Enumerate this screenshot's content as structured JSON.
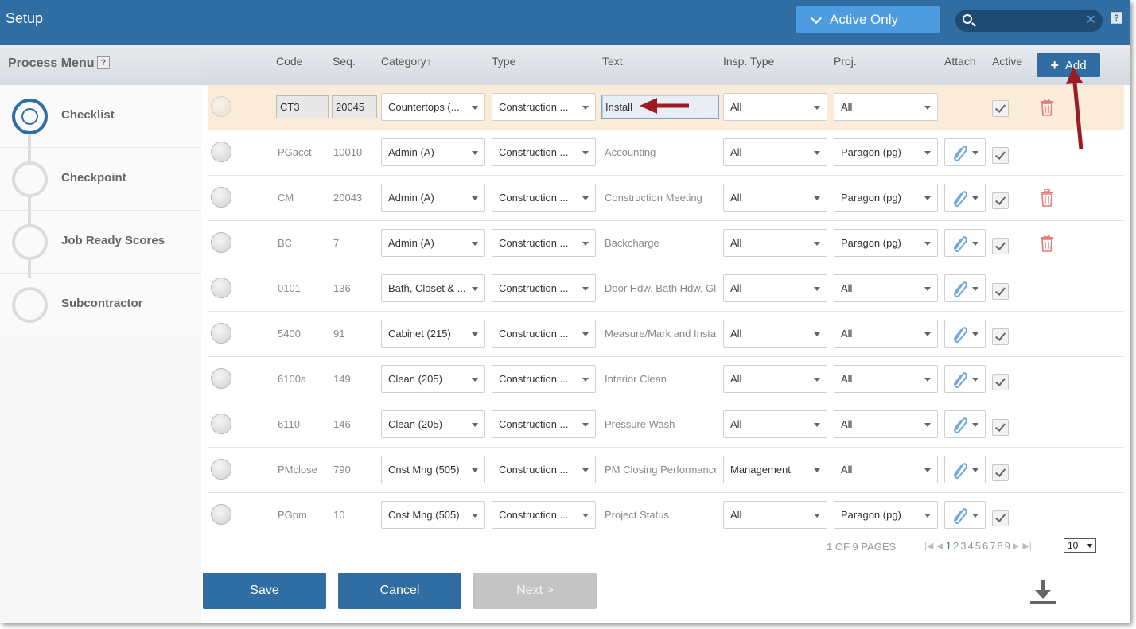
{
  "header": {
    "title": "Setup",
    "active_filter_label": "Active Only",
    "search_value": "",
    "help_label": "?"
  },
  "sidebar": {
    "title": "Process Menu",
    "help_label": "?",
    "steps": [
      {
        "label": "Checklist",
        "active": true
      },
      {
        "label": "Checkpoint",
        "active": false
      },
      {
        "label": "Job Ready Scores",
        "active": false
      },
      {
        "label": "Subcontractor",
        "active": false
      }
    ]
  },
  "columns": {
    "code": "Code",
    "seq": "Seq.",
    "category": "Category↑",
    "type": "Type",
    "text": "Text",
    "insp_type": "Insp. Type",
    "proj": "Proj.",
    "attach": "Attach",
    "active": "Active",
    "add_label": "Add"
  },
  "rows": [
    {
      "code": "CT3",
      "seq": "20045",
      "category": "Countertops (...",
      "type": "Construction ...",
      "text": "Install",
      "insp_type": "All",
      "proj": "All",
      "attach": false,
      "active": true,
      "delete": true
    },
    {
      "code": "PGacct",
      "seq": "10010",
      "category": "Admin (A)",
      "type": "Construction ...",
      "text": "Accounting",
      "insp_type": "All",
      "proj": "Paragon (pg)",
      "attach": true,
      "active": true,
      "delete": false
    },
    {
      "code": "CM",
      "seq": "20043",
      "category": "Admin (A)",
      "type": "Construction ...",
      "text": "Construction Meeting",
      "insp_type": "All",
      "proj": "Paragon (pg)",
      "attach": true,
      "active": true,
      "delete": true
    },
    {
      "code": "BC",
      "seq": "7",
      "category": "Admin (A)",
      "type": "Construction ...",
      "text": "Backcharge",
      "insp_type": "All",
      "proj": "Paragon (pg)",
      "attach": true,
      "active": true,
      "delete": true
    },
    {
      "code": "0101",
      "seq": "136",
      "category": "Bath, Closet & ...",
      "type": "Construction ...",
      "text": "Door Hdw, Bath Hdw, Gl",
      "insp_type": "All",
      "proj": "All",
      "attach": true,
      "active": true,
      "delete": false
    },
    {
      "code": "5400",
      "seq": "91",
      "category": "Cabinet (215)",
      "type": "Construction ...",
      "text": "Measure/Mark and Insta",
      "insp_type": "All",
      "proj": "All",
      "attach": true,
      "active": true,
      "delete": false
    },
    {
      "code": "6100a",
      "seq": "149",
      "category": "Clean (205)",
      "type": "Construction ...",
      "text": "Interior Clean",
      "insp_type": "All",
      "proj": "All",
      "attach": true,
      "active": true,
      "delete": false
    },
    {
      "code": "6110",
      "seq": "146",
      "category": "Clean (205)",
      "type": "Construction ...",
      "text": "Pressure Wash",
      "insp_type": "All",
      "proj": "All",
      "attach": true,
      "active": true,
      "delete": false
    },
    {
      "code": "PMclose",
      "seq": "790",
      "category": "Cnst Mng (505)",
      "type": "Construction ...",
      "text": "PM Closing Performance",
      "insp_type": "Management",
      "proj": "All",
      "attach": true,
      "active": true,
      "delete": false
    },
    {
      "code": "PGpm",
      "seq": "10",
      "category": "Cnst Mng (505)",
      "type": "Construction ...",
      "text": "Project Status",
      "insp_type": "All",
      "proj": "Paragon (pg)",
      "attach": true,
      "active": true,
      "delete": false
    }
  ],
  "pager": {
    "info": "1 OF 9 PAGES",
    "pages": [
      "1",
      "2",
      "3",
      "4",
      "5",
      "6",
      "7",
      "8",
      "9"
    ],
    "current_page": "1",
    "page_size": "10"
  },
  "footer": {
    "save_label": "Save",
    "cancel_label": "Cancel",
    "next_label": "Next >"
  },
  "colors": {
    "brand": "#2f6da2",
    "accent": "#4e9ce0",
    "editing_row": "#fbebd9",
    "delete": "#d9534f",
    "annotation": "#9b1c26"
  }
}
